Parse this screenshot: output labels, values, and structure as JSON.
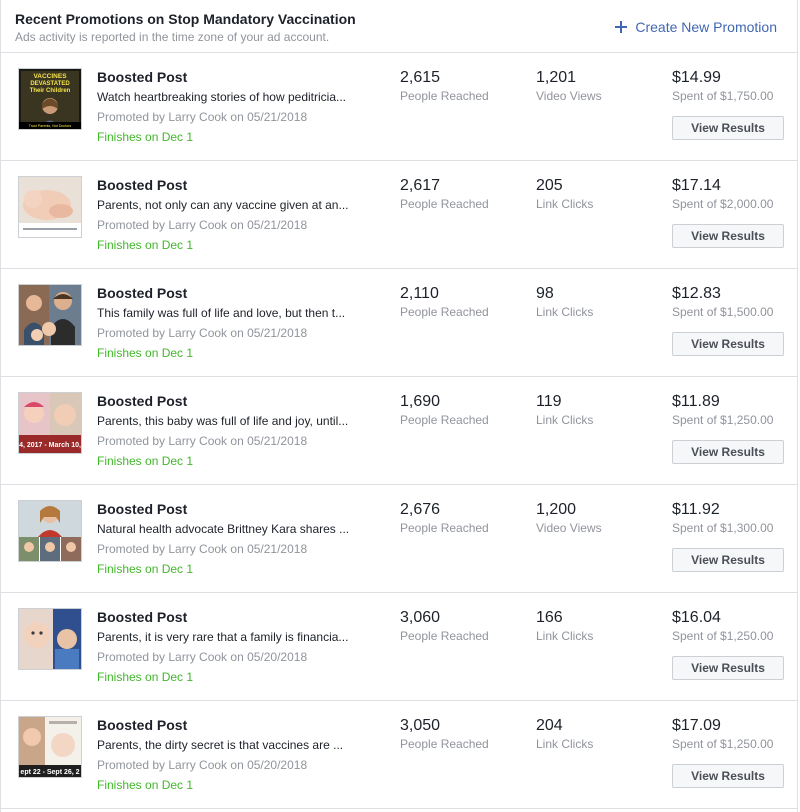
{
  "header": {
    "title": "Recent Promotions on Stop Mandatory Vaccination",
    "subtitle": "Ads activity is reported in the time zone of your ad account.",
    "create_label": "Create New Promotion"
  },
  "rows": [
    {
      "type": "Boosted Post",
      "text": "Watch heartbreaking stories of how peditricia...",
      "promoted_by": "Promoted by Larry Cook on 05/21/2018",
      "finishes": "Finishes on Dec 1",
      "reach": "2,615",
      "reach_label": "People Reached",
      "result": "1,201",
      "result_label": "Video Views",
      "spent": "$14.99",
      "budget": "Spent of $1,750.00",
      "button": "View Results",
      "thumb_lines": [
        "VACCINES",
        "DEVASTATED",
        "Their Children",
        "Trust Parents, Not Doctors"
      ]
    },
    {
      "type": "Boosted Post",
      "text": "Parents, not only can any vaccine given at an...",
      "promoted_by": "Promoted by Larry Cook on 05/21/2018",
      "finishes": "Finishes on Dec 1",
      "reach": "2,617",
      "reach_label": "People Reached",
      "result": "205",
      "result_label": "Link Clicks",
      "spent": "$17.14",
      "budget": "Spent of $2,000.00",
      "button": "View Results"
    },
    {
      "type": "Boosted Post",
      "text": "This family was full of life and love, but then t...",
      "promoted_by": "Promoted by Larry Cook on 05/21/2018",
      "finishes": "Finishes on Dec 1",
      "reach": "2,110",
      "reach_label": "People Reached",
      "result": "98",
      "result_label": "Link Clicks",
      "spent": "$12.83",
      "budget": "Spent of $1,500.00",
      "button": "View Results"
    },
    {
      "type": "Boosted Post",
      "text": "Parents, this baby was full of life and joy, until...",
      "promoted_by": "Promoted by Larry Cook on 05/21/2018",
      "finishes": "Finishes on Dec 1",
      "reach": "1,690",
      "reach_label": "People Reached",
      "result": "119",
      "result_label": "Link Clicks",
      "spent": "$11.89",
      "budget": "Spent of $1,250.00",
      "button": "View Results",
      "thumb_lines": [
        "4, 2017 - March 10,"
      ]
    },
    {
      "type": "Boosted Post",
      "text": "Natural health advocate Brittney Kara shares ...",
      "promoted_by": "Promoted by Larry Cook on 05/21/2018",
      "finishes": "Finishes on Dec 1",
      "reach": "2,676",
      "reach_label": "People Reached",
      "result": "1,200",
      "result_label": "Video Views",
      "spent": "$11.92",
      "budget": "Spent of $1,300.00",
      "button": "View Results"
    },
    {
      "type": "Boosted Post",
      "text": "Parents, it is very rare that a family is financia...",
      "promoted_by": "Promoted by Larry Cook on 05/20/2018",
      "finishes": "Finishes on Dec 1",
      "reach": "3,060",
      "reach_label": "People Reached",
      "result": "166",
      "result_label": "Link Clicks",
      "spent": "$16.04",
      "budget": "Spent of $1,250.00",
      "button": "View Results"
    },
    {
      "type": "Boosted Post",
      "text": "Parents, the dirty secret is that vaccines are ...",
      "promoted_by": "Promoted by Larry Cook on 05/20/2018",
      "finishes": "Finishes on Dec 1",
      "reach": "3,050",
      "reach_label": "People Reached",
      "result": "204",
      "result_label": "Link Clicks",
      "spent": "$17.09",
      "budget": "Spent of $1,250.00",
      "button": "View Results",
      "thumb_lines": [
        "ept 22 - Sept 26, 2"
      ]
    }
  ],
  "colors": {
    "link_blue": "#4267b2",
    "green": "#42b72a",
    "muted": "#90949c",
    "border": "#dddfe2"
  }
}
